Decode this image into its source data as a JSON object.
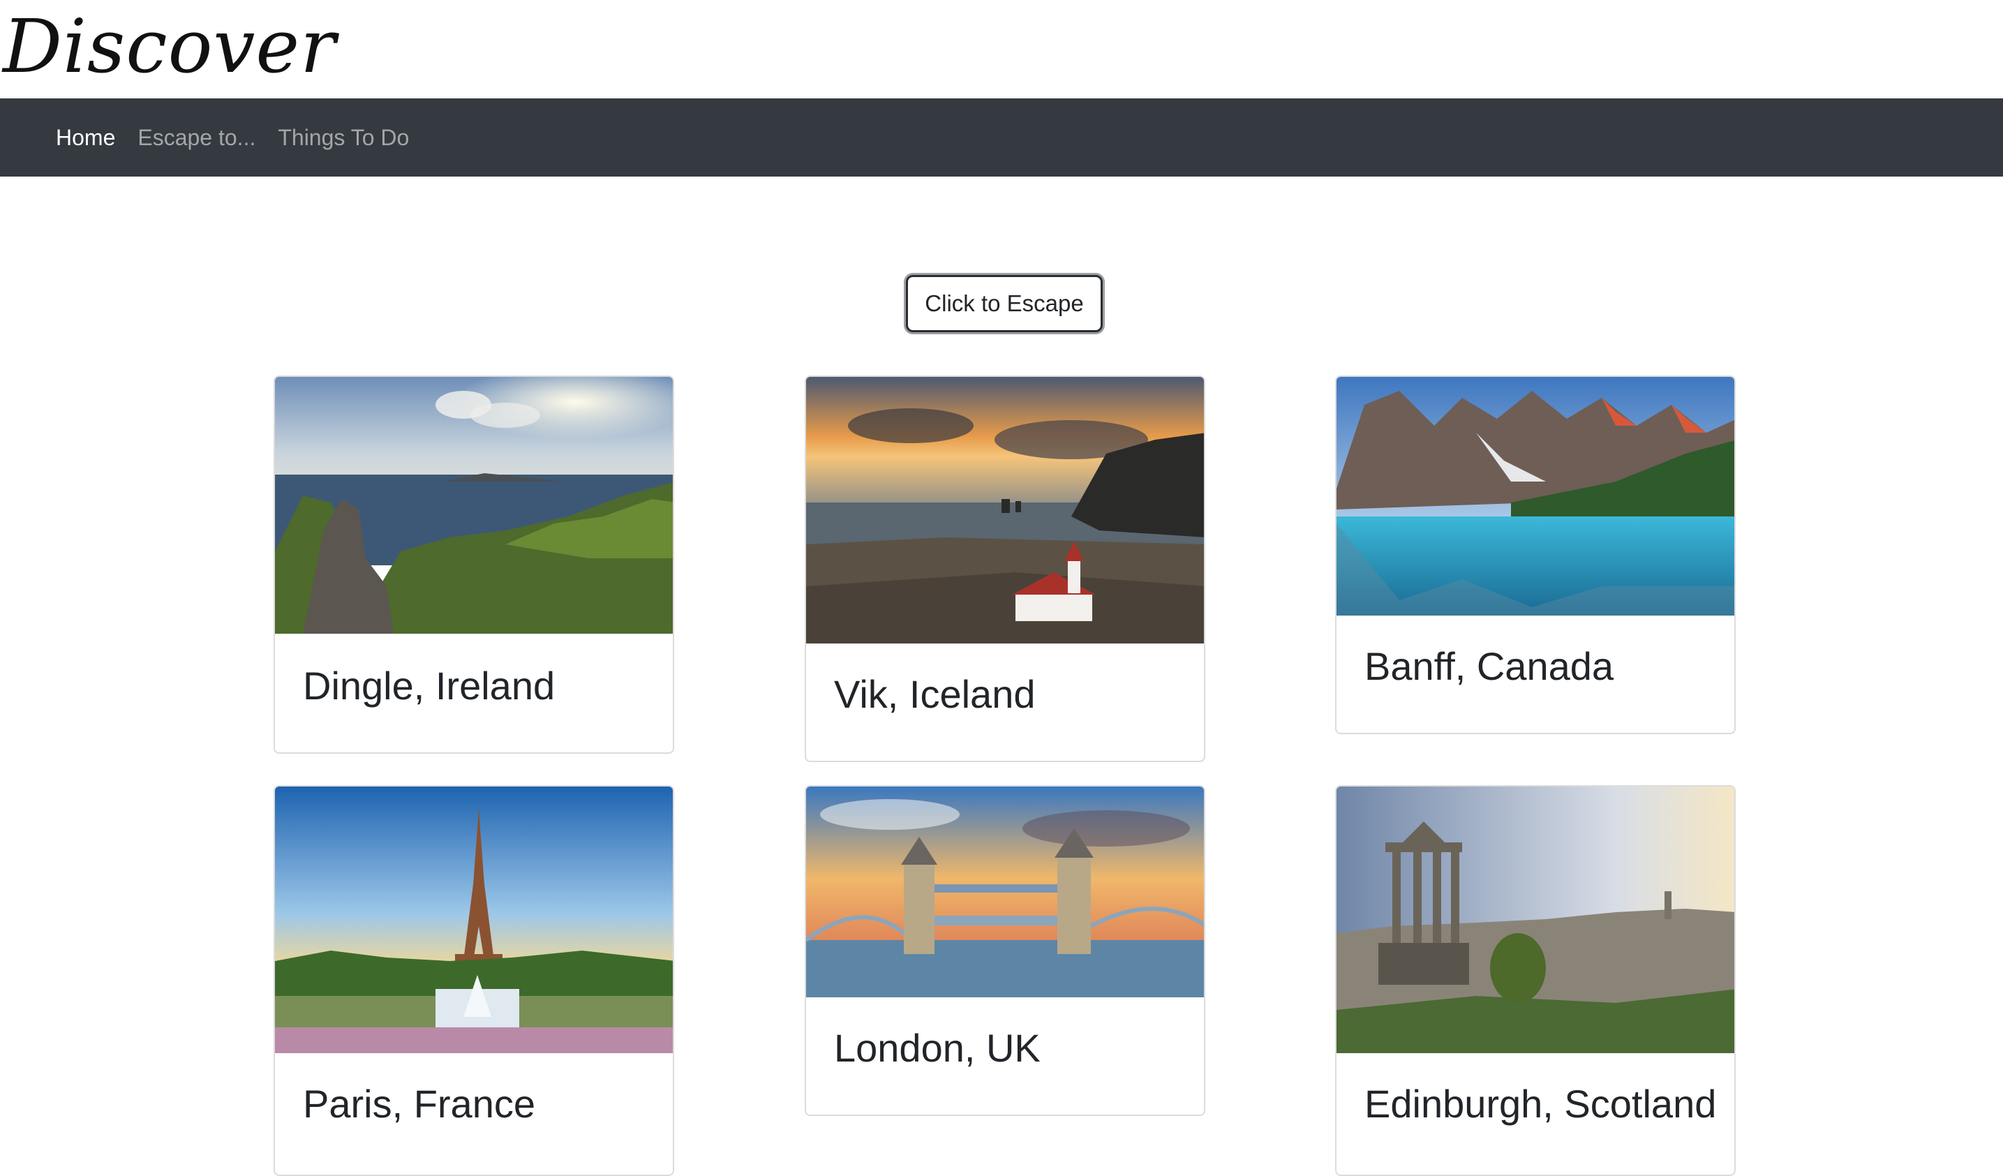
{
  "brand": "Discover",
  "nav": {
    "items": [
      {
        "label": "Home",
        "active": true
      },
      {
        "label": "Escape to...",
        "active": false
      },
      {
        "label": "Things To Do",
        "active": false
      }
    ]
  },
  "escape_button": "Click to Escape",
  "cards": [
    {
      "title": "Dingle, Ireland"
    },
    {
      "title": "Vik, Iceland"
    },
    {
      "title": "Banff, Canada"
    },
    {
      "title": "Paris, France"
    },
    {
      "title": "London, UK"
    },
    {
      "title": "Edinburgh, Scotland"
    }
  ],
  "colors": {
    "navbar": "#343a40",
    "nav_active": "#ffffff",
    "nav_inactive": "#9a9da0"
  }
}
